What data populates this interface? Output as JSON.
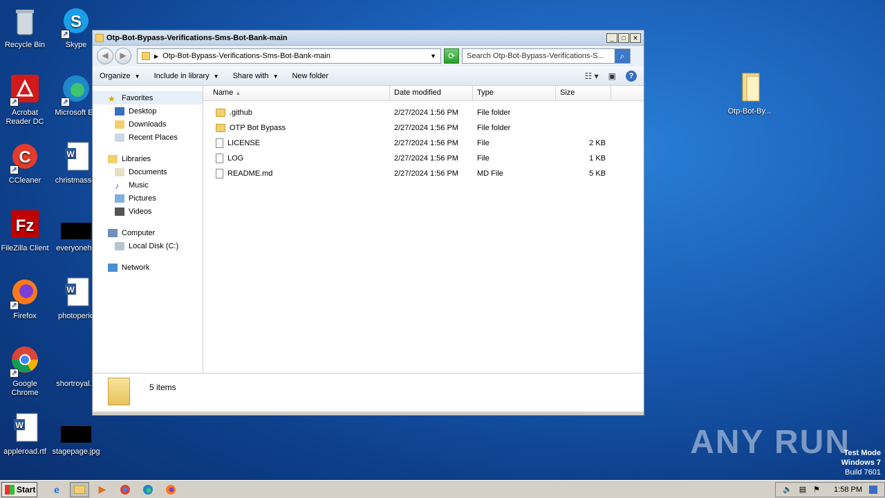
{
  "desktop": {
    "icons": [
      {
        "label": "Recycle Bin",
        "icon": "recycle-bin-icon"
      },
      {
        "label": "Skype",
        "icon": "skype-icon"
      },
      {
        "label": "Acrobat Reader DC",
        "icon": "acrobat-icon"
      },
      {
        "label": "Microsoft Edge",
        "icon": "edge-icon"
      },
      {
        "label": "CCleaner",
        "icon": "ccleaner-icon"
      },
      {
        "label": "christmassci",
        "icon": "word-doc-icon"
      },
      {
        "label": "FileZilla Client",
        "icon": "filezilla-icon"
      },
      {
        "label": "everyoneho",
        "icon": "black-thumbnail-icon"
      },
      {
        "label": "Firefox",
        "icon": "firefox-icon"
      },
      {
        "label": "photoperio",
        "icon": "word-doc-icon"
      },
      {
        "label": "Google Chrome",
        "icon": "chrome-icon"
      },
      {
        "label": "shortroyal.p",
        "icon": "file-icon"
      },
      {
        "label": "appleroad.rtf",
        "icon": "word-doc-icon"
      },
      {
        "label": "stagepage.jpg",
        "icon": "black-thumbnail-icon"
      },
      {
        "label": "Otp-Bot-By...",
        "icon": "folder-icon"
      }
    ]
  },
  "window": {
    "title": "Otp-Bot-Bypass-Verifications-Sms-Bot-Bank-main",
    "address": "Otp-Bot-Bypass-Verifications-Sms-Bot-Bank-main",
    "search_placeholder": "Search Otp-Bot-Bypass-Verifications-S...",
    "toolbar": {
      "organize": "Organize",
      "include": "Include in library",
      "share": "Share with",
      "new_folder": "New folder"
    },
    "nav": {
      "favorites": "Favorites",
      "desktop": "Desktop",
      "downloads": "Downloads",
      "recent": "Recent Places",
      "libraries": "Libraries",
      "documents": "Documents",
      "music": "Music",
      "pictures": "Pictures",
      "videos": "Videos",
      "computer": "Computer",
      "local_disk": "Local Disk (C:)",
      "network": "Network"
    },
    "columns": {
      "name": "Name",
      "date": "Date modified",
      "type": "Type",
      "size": "Size"
    },
    "files": [
      {
        "name": ".github",
        "date": "2/27/2024 1:56 PM",
        "type": "File folder",
        "size": "",
        "kind": "folder"
      },
      {
        "name": "OTP Bot Bypass",
        "date": "2/27/2024 1:56 PM",
        "type": "File folder",
        "size": "",
        "kind": "folder"
      },
      {
        "name": "LICENSE",
        "date": "2/27/2024 1:56 PM",
        "type": "File",
        "size": "2 KB",
        "kind": "file"
      },
      {
        "name": "LOG",
        "date": "2/27/2024 1:56 PM",
        "type": "File",
        "size": "1 KB",
        "kind": "file"
      },
      {
        "name": "README.md",
        "date": "2/27/2024 1:56 PM",
        "type": "MD File",
        "size": "5 KB",
        "kind": "file"
      }
    ],
    "status_count": "5 items"
  },
  "taskbar": {
    "start": "Start",
    "clock": "1:58 PM"
  },
  "overlay": {
    "watermark": "ANY RUN",
    "test_mode": "Test Mode",
    "os": "Windows 7",
    "build": "Build 7601"
  }
}
